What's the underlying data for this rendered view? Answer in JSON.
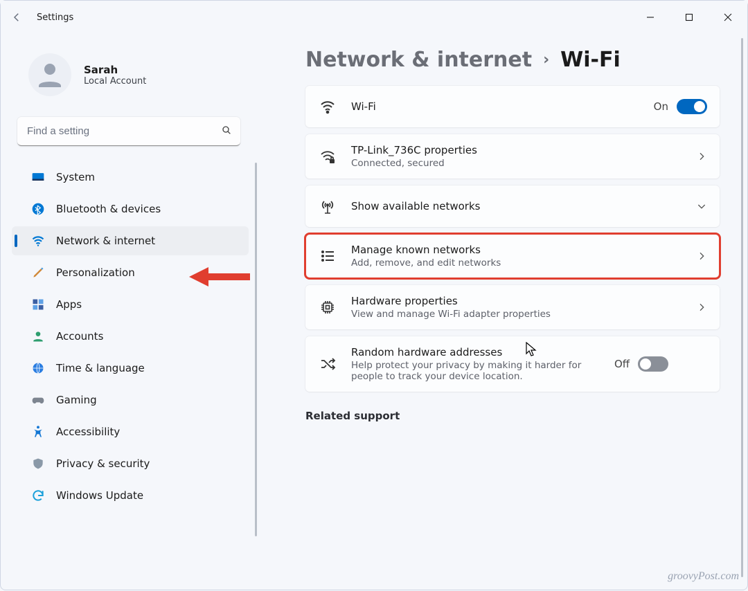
{
  "window": {
    "title": "Settings"
  },
  "user": {
    "name": "Sarah",
    "subtitle": "Local Account"
  },
  "search": {
    "placeholder": "Find a setting"
  },
  "nav": {
    "items": [
      {
        "icon": "system",
        "label": "System"
      },
      {
        "icon": "bluetooth",
        "label": "Bluetooth & devices"
      },
      {
        "icon": "wifi",
        "label": "Network & internet"
      },
      {
        "icon": "personalize",
        "label": "Personalization"
      },
      {
        "icon": "apps",
        "label": "Apps"
      },
      {
        "icon": "accounts",
        "label": "Accounts"
      },
      {
        "icon": "time",
        "label": "Time & language"
      },
      {
        "icon": "gaming",
        "label": "Gaming"
      },
      {
        "icon": "accessibility",
        "label": "Accessibility"
      },
      {
        "icon": "privacy",
        "label": "Privacy & security"
      },
      {
        "icon": "update",
        "label": "Windows Update"
      }
    ],
    "selected_index": 2
  },
  "breadcrumb": {
    "parent": "Network & internet",
    "current": "Wi-Fi"
  },
  "cards": {
    "wifi": {
      "title": "Wi-Fi",
      "toggle_label": "On",
      "toggle_on": true
    },
    "props": {
      "title": "TP-Link_736C properties",
      "subtitle": "Connected, secured"
    },
    "avail": {
      "title": "Show available networks"
    },
    "manage": {
      "title": "Manage known networks",
      "subtitle": "Add, remove, and edit networks"
    },
    "hw": {
      "title": "Hardware properties",
      "subtitle": "View and manage Wi-Fi adapter properties"
    },
    "random": {
      "title": "Random hardware addresses",
      "subtitle": "Help protect your privacy by making it harder for people to track your device location.",
      "toggle_label": "Off",
      "toggle_on": false
    }
  },
  "related": {
    "heading": "Related support"
  },
  "watermark": "groovyPost.com",
  "colors": {
    "accent": "#0067c0",
    "highlight": "#e03e2f"
  }
}
